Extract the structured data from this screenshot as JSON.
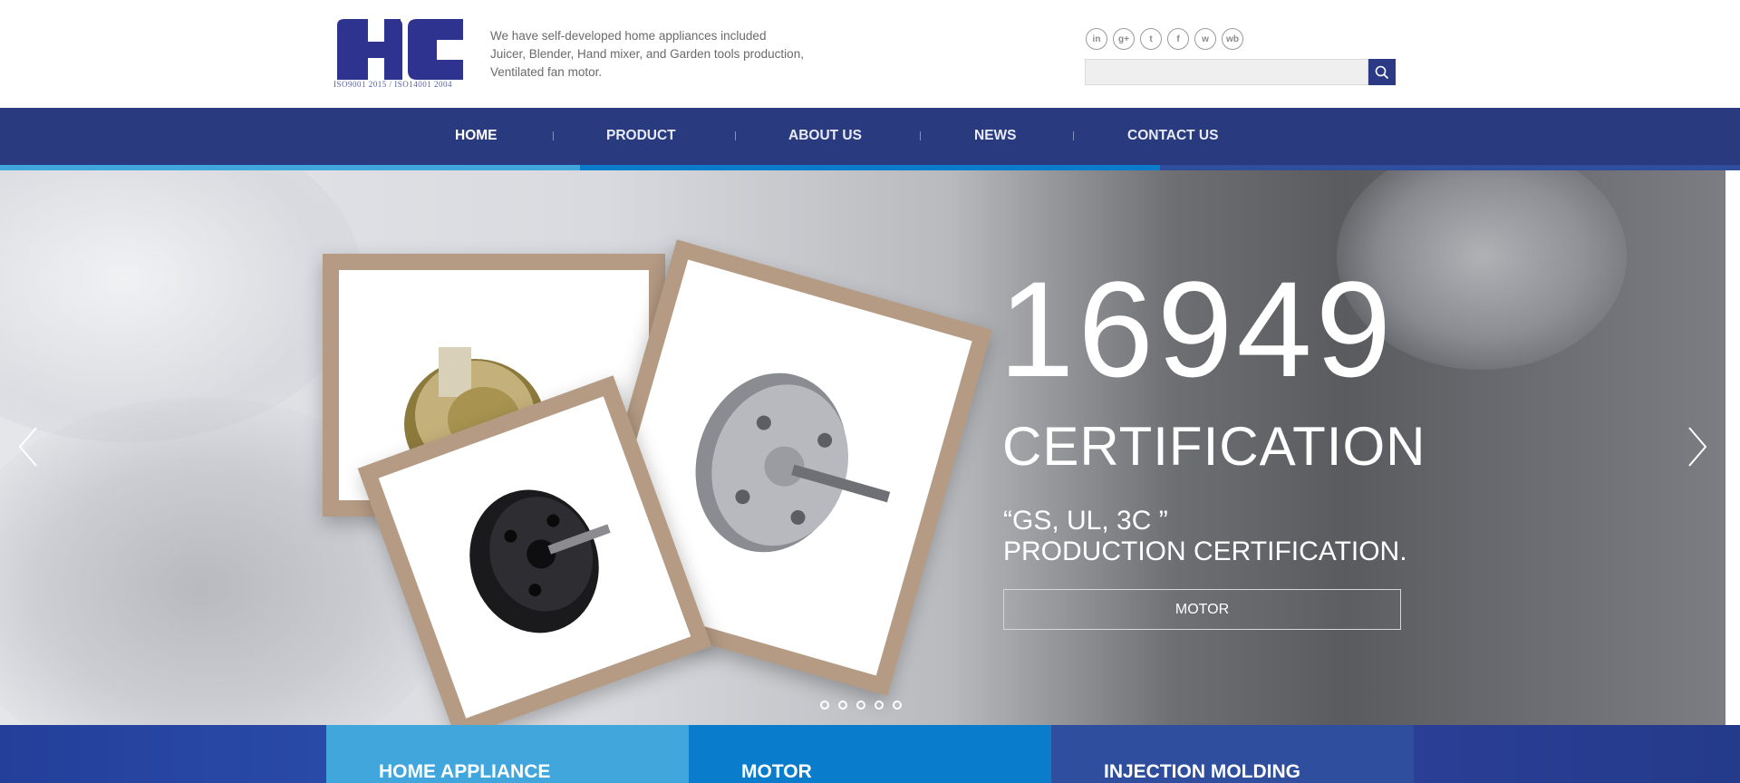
{
  "header": {
    "logo": {
      "iso_text": "ISO9001 2015 / ISO14001 2004",
      "brand_color": "#2e3390"
    },
    "tagline": [
      "We have self-developed home appliances included",
      "Juicer, Blender, Hand mixer, and Garden tools production,",
      "Ventilated fan motor."
    ],
    "social": [
      {
        "name": "linkedin-icon",
        "glyph": "in"
      },
      {
        "name": "google-plus-icon",
        "glyph": "g+"
      },
      {
        "name": "twitter-icon",
        "glyph": "t"
      },
      {
        "name": "facebook-icon",
        "glyph": "f"
      },
      {
        "name": "wechat-icon",
        "glyph": "w"
      },
      {
        "name": "weibo-icon",
        "glyph": "wb"
      }
    ],
    "search": {
      "placeholder": "",
      "value": "",
      "icon": "search-icon"
    }
  },
  "nav": {
    "items": [
      {
        "label": "HOME",
        "active": true
      },
      {
        "label": "PRODUCT"
      },
      {
        "label": "ABOUT US"
      },
      {
        "label": "NEWS"
      },
      {
        "label": "CONTACT US"
      }
    ],
    "colors": {
      "bar": "#2a3a7e",
      "strip": [
        "#41a6dc",
        "#0a7ccc",
        "#2f4f9e"
      ]
    }
  },
  "hero": {
    "number": "16949",
    "title": "CERTIFICATION",
    "quote_line1": "“GS, UL, 3C ”",
    "quote_line2": "PRODUCTION CERTIFICATION.",
    "button": "MOTOR",
    "prev_icon": "chevron-left-icon",
    "next_icon": "chevron-right-icon",
    "slides": 5,
    "active_slide": 1
  },
  "categories": [
    {
      "label": "HOME APPLIANCE",
      "color": "#41a6dc"
    },
    {
      "label": "MOTOR",
      "color": "#0a7ccc"
    },
    {
      "label": "INJECTION MOLDING",
      "color": "#2f4f9e"
    }
  ]
}
